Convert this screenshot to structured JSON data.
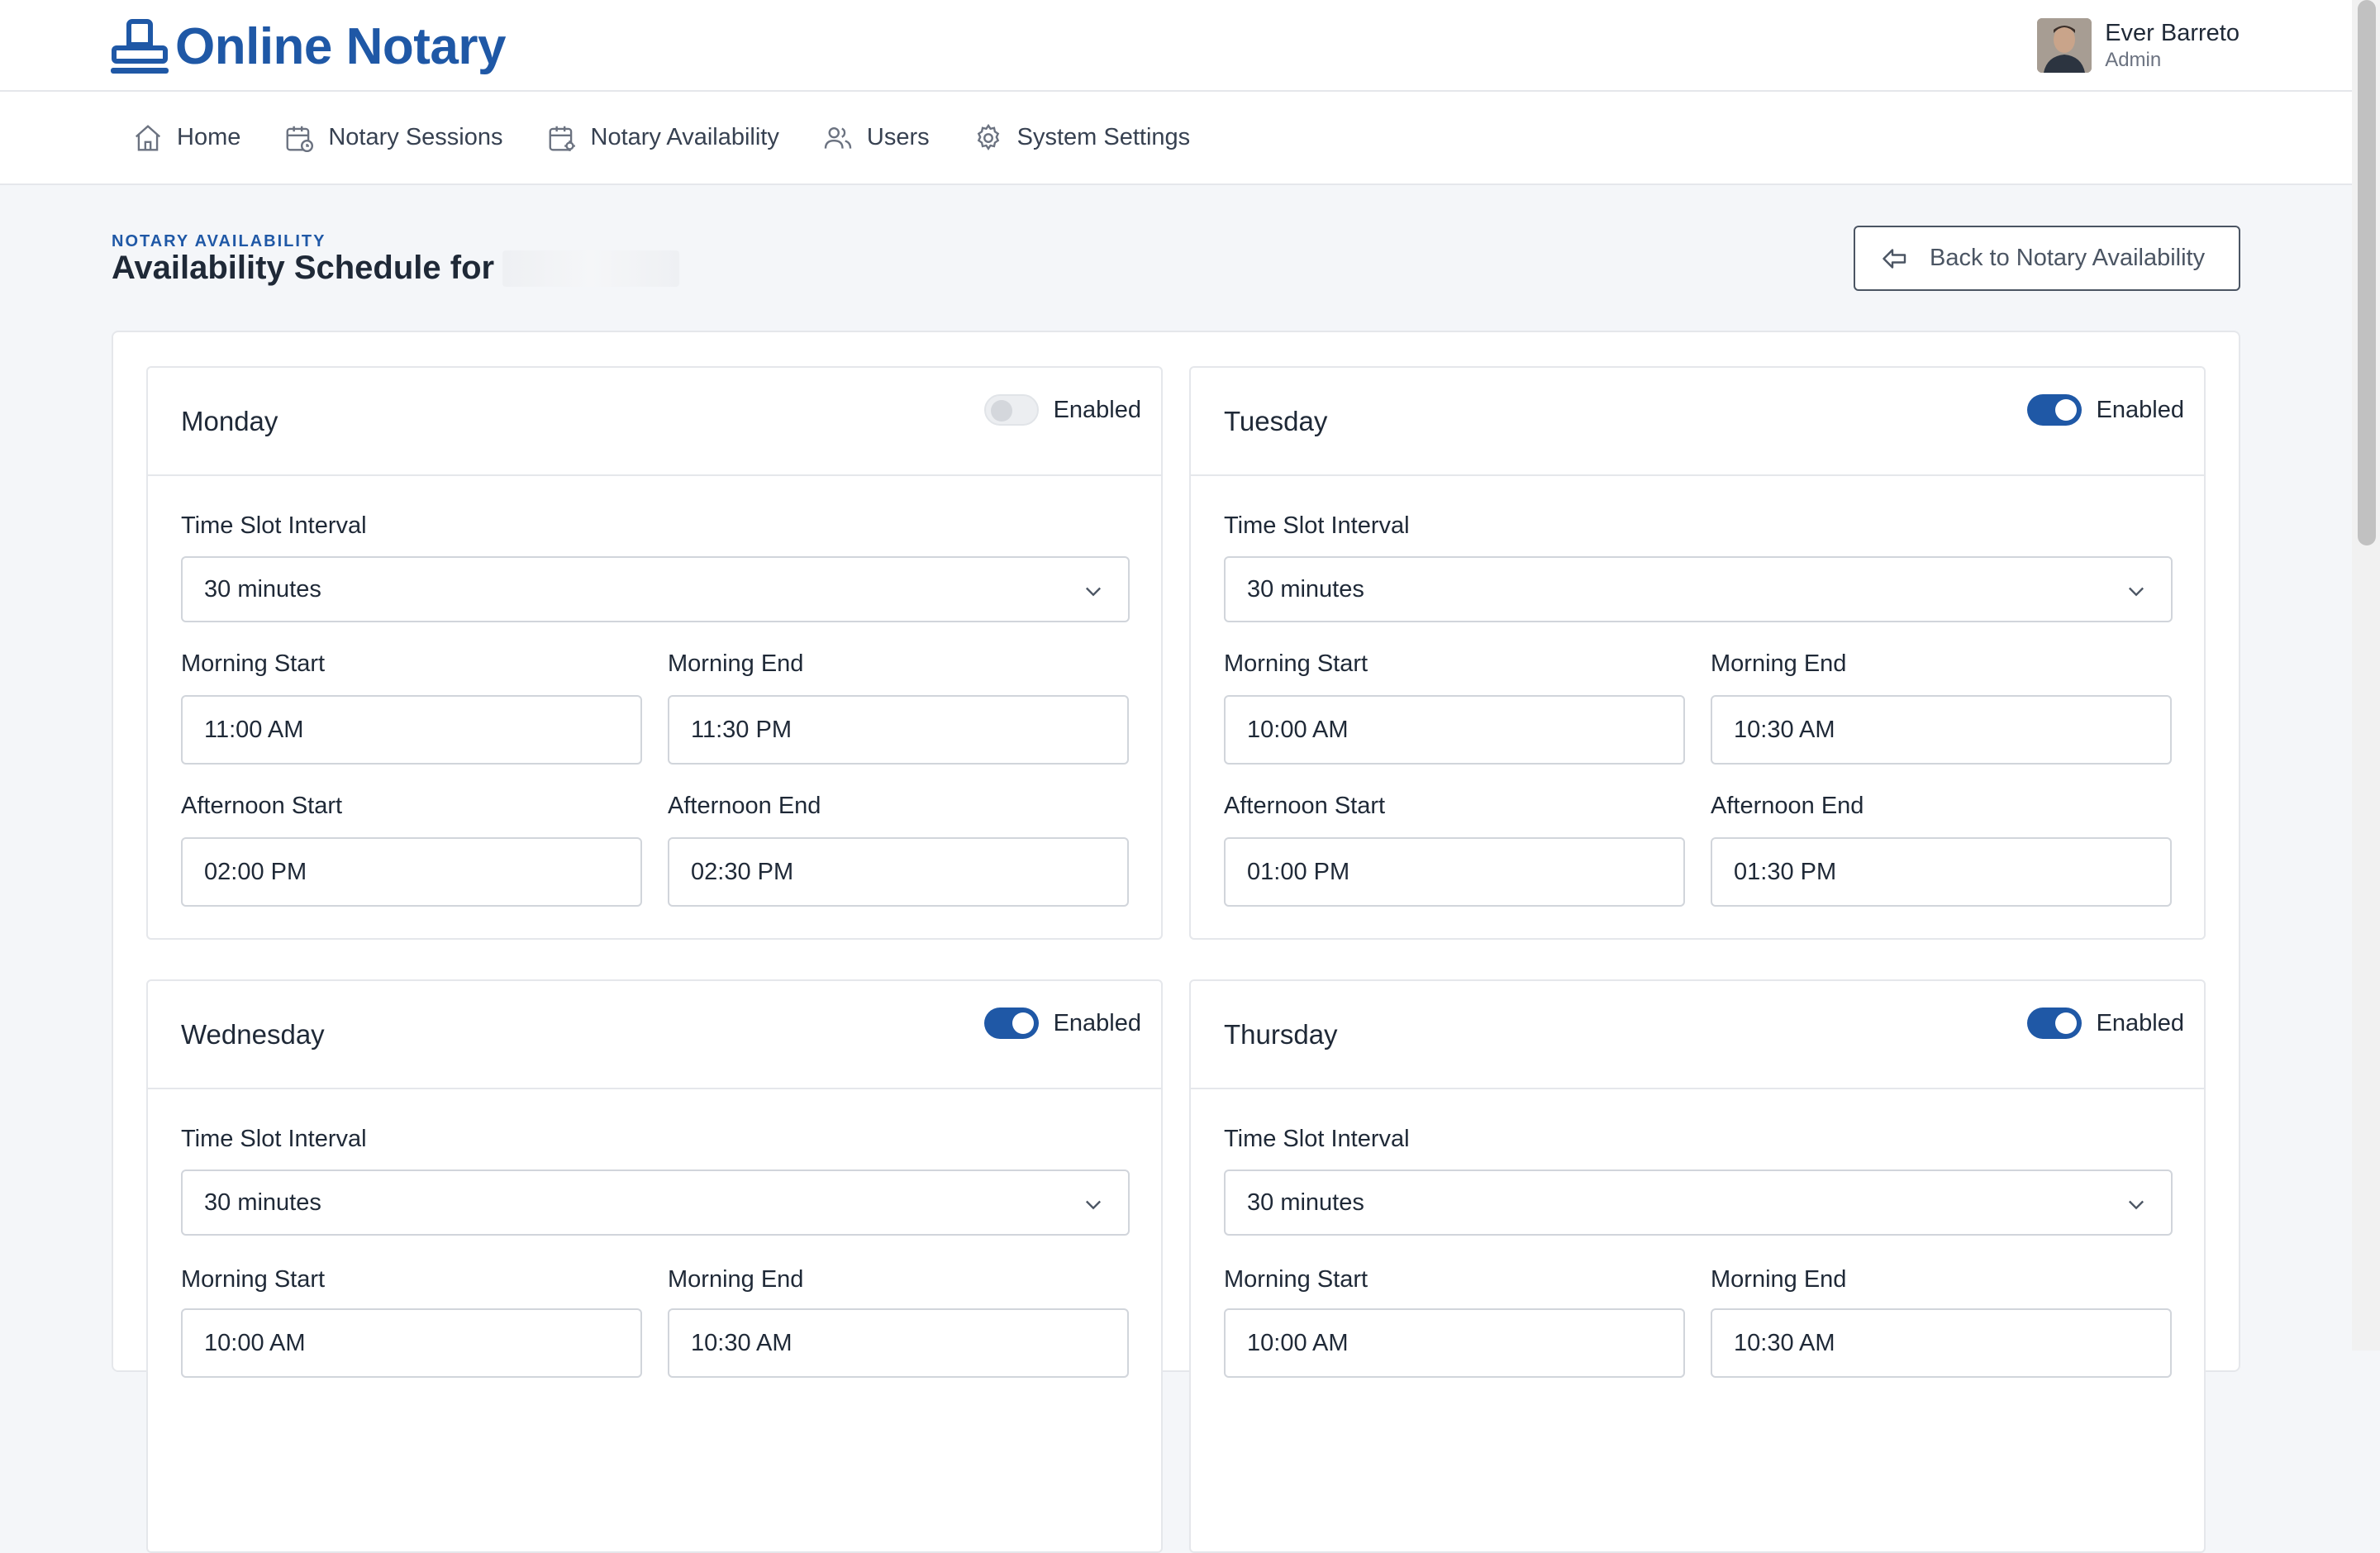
{
  "app": {
    "name": "Online Notary",
    "brand_color": "#1f58a6"
  },
  "user": {
    "name": "Ever Barreto",
    "role": "Admin"
  },
  "nav": {
    "items": [
      {
        "label": "Home",
        "icon": "home-icon"
      },
      {
        "label": "Notary Sessions",
        "icon": "calendar-clock-icon"
      },
      {
        "label": "Notary Availability",
        "icon": "calendar-settings-icon"
      },
      {
        "label": "Users",
        "icon": "users-icon"
      },
      {
        "label": "System Settings",
        "icon": "gear-icon"
      }
    ]
  },
  "page": {
    "eyebrow": "NOTARY AVAILABILITY",
    "title": "Availability Schedule for",
    "back_button": "Back to Notary Availability"
  },
  "labels": {
    "enabled": "Enabled",
    "interval": "Time Slot Interval",
    "morning_start": "Morning Start",
    "morning_end": "Morning End",
    "afternoon_start": "Afternoon Start",
    "afternoon_end": "Afternoon End"
  },
  "days": [
    {
      "name": "Monday",
      "enabled": false,
      "interval": "30 minutes",
      "morning_start": "11:00 AM",
      "morning_end": "11:30 PM",
      "afternoon_start": "02:00 PM",
      "afternoon_end": "02:30 PM"
    },
    {
      "name": "Tuesday",
      "enabled": true,
      "interval": "30 minutes",
      "morning_start": "10:00 AM",
      "morning_end": "10:30 AM",
      "afternoon_start": "01:00 PM",
      "afternoon_end": "01:30 PM"
    },
    {
      "name": "Wednesday",
      "enabled": true,
      "interval": "30 minutes",
      "morning_start": "10:00 AM",
      "morning_end": "10:30 AM"
    },
    {
      "name": "Thursday",
      "enabled": true,
      "interval": "30 minutes",
      "morning_start": "10:00 AM",
      "morning_end": "10:30 AM"
    }
  ]
}
